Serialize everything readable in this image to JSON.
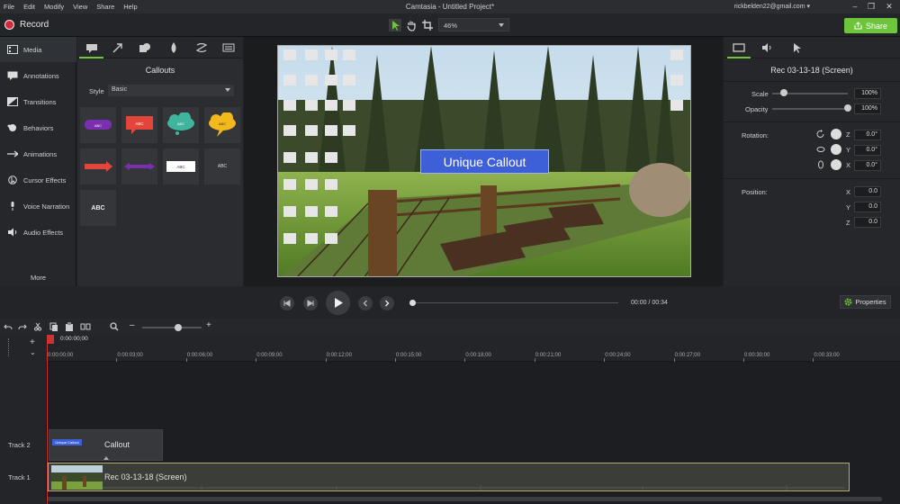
{
  "menu": [
    "File",
    "Edit",
    "Modify",
    "View",
    "Share",
    "Help"
  ],
  "window": {
    "title": "Camtasia - Untitled Project*",
    "account": "rickbelden22@gmail.com"
  },
  "toolbar": {
    "record_label": "Record",
    "zoom": "46%",
    "share_label": "Share"
  },
  "sidebar": {
    "items": [
      {
        "label": "Media",
        "icon": "film-icon"
      },
      {
        "label": "Annotations",
        "icon": "annotation-icon"
      },
      {
        "label": "Transitions",
        "icon": "transition-icon"
      },
      {
        "label": "Behaviors",
        "icon": "behavior-icon"
      },
      {
        "label": "Animations",
        "icon": "animation-icon"
      },
      {
        "label": "Cursor Effects",
        "icon": "cursor-icon"
      },
      {
        "label": "Voice Narration",
        "icon": "microphone-icon"
      },
      {
        "label": "Audio Effects",
        "icon": "speaker-icon"
      }
    ],
    "more": "More"
  },
  "panel": {
    "title": "Callouts",
    "style_label": "Style",
    "style_value": "Basic",
    "callouts": [
      {
        "text": "ABC",
        "color": "#7a2fb0"
      },
      {
        "text": "ABC",
        "color": "#e4453a"
      },
      {
        "text": "ABC",
        "color": "#3fb59e"
      },
      {
        "text": "ABC",
        "color": "#f2b81c"
      },
      {
        "text": "",
        "color": "#e4453a"
      },
      {
        "text": "",
        "color": "#7a2fb0"
      },
      {
        "text": "ABC",
        "color": "#ffffff"
      },
      {
        "text": "ABC",
        "color": "#34363a"
      },
      {
        "text": "ABC",
        "color": "#34363a"
      }
    ]
  },
  "canvas": {
    "callout_text": "Unique Callout"
  },
  "props": {
    "title": "Rec 03-13-18 (Screen)",
    "scale_label": "Scale",
    "scale_value": "100%",
    "scale_level": 0.15,
    "opacity_label": "Opacity",
    "opacity_value": "100%",
    "opacity_level": 1.0,
    "rotation_label": "Rotation:",
    "rot_z": "0.0°",
    "rot_y": "0.0°",
    "rot_x": "0.0°",
    "position_label": "Position:",
    "pos_x": "0.0",
    "pos_y": "0.0",
    "pos_z": "0.0",
    "axis_z": "Z",
    "axis_y": "Y",
    "axis_x": "X"
  },
  "playback": {
    "current": "00:00",
    "sep": "/",
    "total": "00:34",
    "properties_label": "Properties",
    "progress": 0.0
  },
  "timeline": {
    "playhead_time": "0:00:00;00",
    "ticks": [
      "0:00:00;00",
      "0:00:03;00",
      "0:00:06;00",
      "0:00:09;00",
      "0:00:12;00",
      "0:00:15;00",
      "0:00:18;00",
      "0:00:21;00",
      "0:00:24;00",
      "0:00:27;00",
      "0:00:30;00",
      "0:00:33;00"
    ],
    "tracks": [
      "Track 2",
      "Track 1"
    ],
    "clip_callout": "Callout",
    "clip_callout_mini": "Unique Callout",
    "clip_rec": "Rec 03-13-18 (Screen)"
  },
  "colors": {
    "accent": "#6ec43a",
    "record": "#d8283b",
    "callout": "#3d5fd8"
  }
}
